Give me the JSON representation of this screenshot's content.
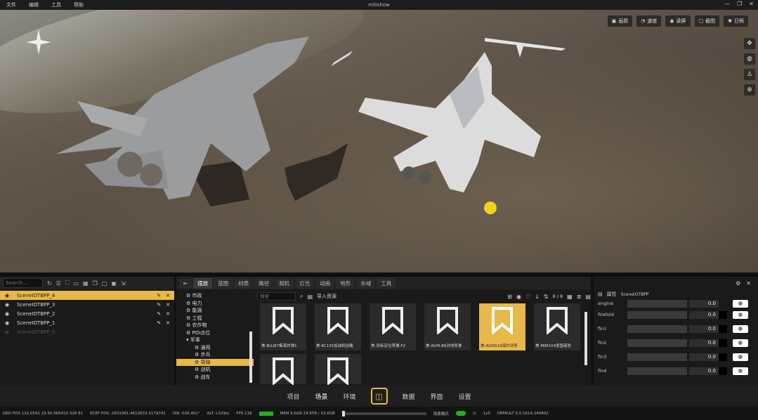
{
  "menu": {
    "items": [
      "文件",
      "编辑",
      "工具",
      "帮助"
    ],
    "title": "milishow"
  },
  "viewport": {
    "top_buttons": [
      {
        "icon": "image-icon",
        "label": "画质"
      },
      {
        "icon": "gauge-icon",
        "label": "速度"
      },
      {
        "icon": "record-icon",
        "label": "录屏"
      },
      {
        "icon": "screenshot-icon",
        "label": "截图"
      },
      {
        "icon": "sun-icon",
        "label": "日照"
      }
    ],
    "side_tools": [
      "move-icon",
      "globe-icon",
      "person-icon",
      "globe2-icon"
    ]
  },
  "scene_panel": {
    "search_placeholder": "Search...",
    "items": [
      {
        "label": "SceneIOTBPP_4",
        "selected": true
      },
      {
        "label": "SceneIOTBPP_3",
        "selected": false
      },
      {
        "label": "SceneIOTBPP_2",
        "selected": false
      },
      {
        "label": "SceneIOTBPP_1",
        "selected": false
      },
      {
        "label": "SceneIOTBPP_0",
        "selected": false
      }
    ]
  },
  "asset_panel": {
    "tabs": [
      "摆放",
      "蓝图",
      "材质",
      "路径",
      "相机",
      "灯光",
      "动画",
      "地形",
      "水域",
      "工具"
    ],
    "active_tab": "摆放",
    "tree": [
      {
        "label": "市政",
        "indent": 1,
        "selected": false
      },
      {
        "label": "电力",
        "indent": 1,
        "selected": false
      },
      {
        "label": "能源",
        "indent": 1,
        "selected": false
      },
      {
        "label": "工程",
        "indent": 1,
        "selected": false
      },
      {
        "label": "农作物",
        "indent": 1,
        "selected": false
      },
      {
        "label": "POI点位",
        "indent": 1,
        "selected": false
      },
      {
        "label": "军事",
        "indent": 1,
        "selected": false
      },
      {
        "label": "通用",
        "indent": 2,
        "selected": false
      },
      {
        "label": "步兵",
        "indent": 2,
        "selected": false
      },
      {
        "label": "导弹",
        "indent": 2,
        "selected": true
      },
      {
        "label": "战机",
        "indent": 2,
        "selected": false
      },
      {
        "label": "战车",
        "indent": 2,
        "selected": false
      }
    ],
    "search_placeholder": "搜索",
    "import_label": "导入资源",
    "page": "8 / 8",
    "cards": [
      {
        "label": "美-BLU87集束炸弹1",
        "selected": false
      },
      {
        "label": "美-KC135加油机挂载",
        "selected": false
      },
      {
        "label": "美-目标定位导弹-F2",
        "selected": false
      },
      {
        "label": "美-AGM-88对地导弹",
        "selected": false
      },
      {
        "label": "美-AGM114海尔法导",
        "selected": true
      },
      {
        "label": "美-MIM104爱国者防",
        "selected": false
      },
      {
        "label": "",
        "selected": false
      },
      {
        "label": "",
        "selected": false
      }
    ]
  },
  "properties": {
    "header": "属性",
    "object": "SceneIOTBPP",
    "rows": [
      {
        "name": "engine",
        "value": "0.0"
      },
      {
        "name": "firefold",
        "value": "0.0"
      },
      {
        "name": "fin1",
        "value": "0.0"
      },
      {
        "name": "fin2",
        "value": "0.0"
      },
      {
        "name": "fin3",
        "value": "0.0"
      },
      {
        "name": "fin4",
        "value": "0.0"
      }
    ]
  },
  "bottom_nav": {
    "left": [
      "项目",
      "场景",
      "环境"
    ],
    "right": [
      "数据",
      "界面",
      "设置"
    ],
    "active": "场景"
  },
  "status": {
    "geo_pos": "GEO POS  122.0591 23.50 965910.328 81",
    "ecef_pos": "ECEF POS  -2931061.4610633.2179741",
    "dir": "DIR  -026.461°",
    "alt": "ALT  +329m",
    "fps": "FPS  116",
    "mem": "MEM  6.6GB  24.6TB / 53.6GB",
    "mode": "场景模式",
    "ratio": "1x5",
    "default": "DEFAULT  5.0.1614.240802"
  }
}
